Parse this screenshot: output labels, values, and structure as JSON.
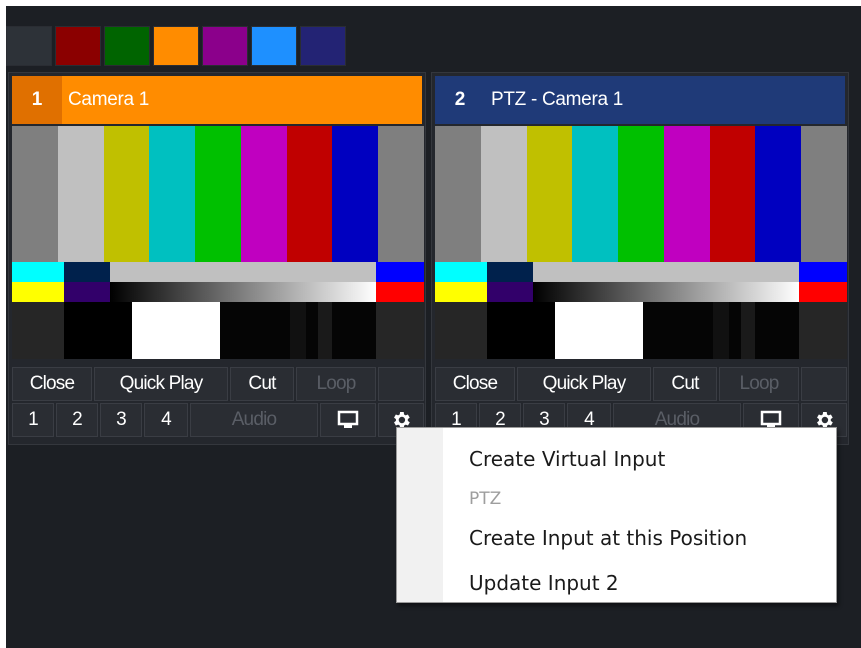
{
  "color_tabs": [
    {
      "color": "#2d3238"
    },
    {
      "color": "#8b0000"
    },
    {
      "color": "#006400"
    },
    {
      "color": "#ff8c00"
    },
    {
      "color": "#8b008b"
    },
    {
      "color": "#1e90ff"
    },
    {
      "color": "#232374"
    }
  ],
  "inputs": [
    {
      "number": "1",
      "title": "Camera 1",
      "header_color": "#ff8c00",
      "num_color": "#e07000",
      "buttons": {
        "close": "Close",
        "quick_play": "Quick Play",
        "cut": "Cut",
        "loop": "Loop"
      },
      "overlays": [
        "1",
        "2",
        "3",
        "4"
      ],
      "audio": "Audio",
      "monitor_icon": "monitor-icon",
      "settings_icon": "gear-icon"
    },
    {
      "number": "2",
      "title": "PTZ - Camera 1",
      "header_color": "#1f3a78",
      "num_color": "#1f3a78",
      "buttons": {
        "close": "Close",
        "quick_play": "Quick Play",
        "cut": "Cut",
        "loop": "Loop"
      },
      "overlays": [
        "1",
        "2",
        "3",
        "4"
      ],
      "audio": "Audio",
      "monitor_icon": "monitor-icon",
      "settings_icon": "gear-icon"
    }
  ],
  "context_menu": {
    "items": [
      {
        "label": "Create Virtual Input",
        "enabled": true
      },
      {
        "label": "PTZ",
        "enabled": false
      },
      {
        "label": "Create Input at this Position",
        "enabled": true
      },
      {
        "label": "Update Input 2",
        "enabled": true
      }
    ]
  }
}
